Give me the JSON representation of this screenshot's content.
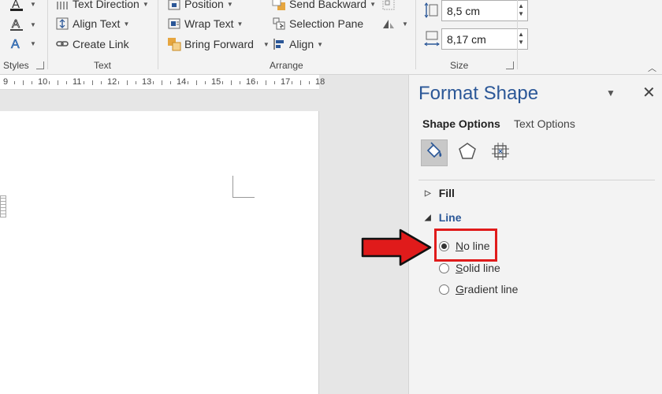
{
  "ribbon": {
    "styles_label": "Styles",
    "text_group": {
      "label": "Text",
      "text_direction": "Text Direction",
      "align_text": "Align Text",
      "create_link": "Create Link"
    },
    "arrange_group": {
      "label": "Arrange",
      "position": "Position",
      "wrap_text": "Wrap Text",
      "bring_forward": "Bring Forward",
      "send_backward": "Send Backward",
      "selection_pane": "Selection Pane",
      "align": "Align"
    },
    "size_group": {
      "label": "Size",
      "height": "8,5 cm",
      "width": "8,17 cm"
    }
  },
  "ruler": {
    "numbers": [
      "9",
      "10",
      "11",
      "12",
      "13",
      "14",
      "15",
      "16",
      "17",
      "18"
    ]
  },
  "pane": {
    "title": "Format Shape",
    "tab_shape_options": "Shape Options",
    "tab_text_options": "Text Options",
    "section_fill": "Fill",
    "section_line": "Line",
    "options": [
      {
        "first": "N",
        "rest": "o line",
        "checked": true
      },
      {
        "first": "S",
        "rest": "olid line",
        "checked": false
      },
      {
        "first": "G",
        "rest": "radient line",
        "checked": false
      }
    ]
  },
  "colors": {
    "accent": "#2b5797",
    "highlight": "#e01b1b"
  }
}
